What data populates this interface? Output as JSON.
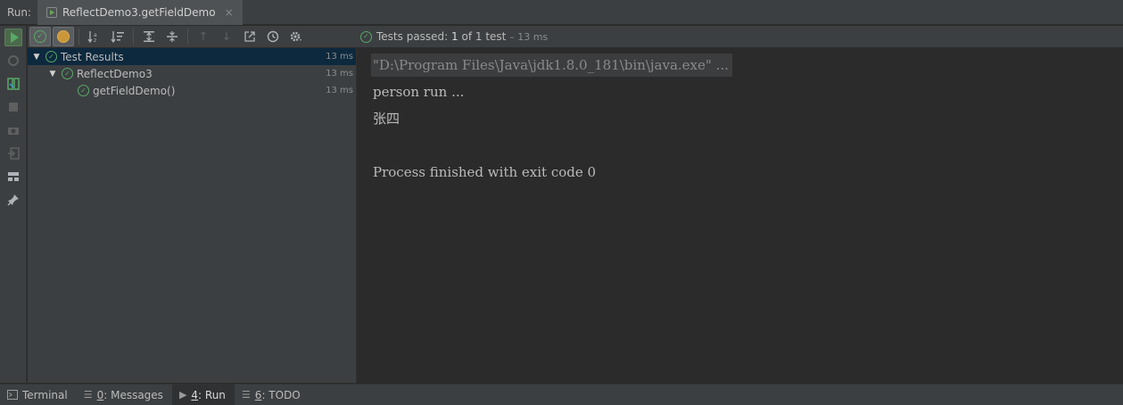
{
  "header": {
    "run_label": "Run:",
    "tab_title": "ReflectDemo3.getFieldDemo",
    "tab_close": "×"
  },
  "toolbar": {
    "icons": [
      "rerun",
      "show-passed",
      "show-ignored",
      "sort-alpha",
      "sort-duration",
      "expand-all",
      "collapse-all",
      "prev-failed",
      "next-failed",
      "export",
      "history",
      "settings"
    ]
  },
  "status": {
    "prefix": "Tests passed:",
    "passed": "1",
    "of_text": "of 1 test",
    "duration": "– 13 ms"
  },
  "tree": {
    "rows": [
      {
        "label": "Test Results",
        "time": "13 ms"
      },
      {
        "label": "ReflectDemo3",
        "time": "13 ms"
      },
      {
        "label": "getFieldDemo()",
        "time": "13 ms"
      }
    ]
  },
  "console": {
    "lines": [
      "\"D:\\Program Files\\Java\\jdk1.8.0_181\\bin\\java.exe\" ...",
      "person run ...",
      "张四",
      "",
      "Process finished with exit code 0"
    ]
  },
  "bottom": {
    "terminal": "Terminal",
    "messages_num": "0",
    "messages": ": Messages",
    "run_num": "4",
    "run": ": Run",
    "todo_num": "6",
    "todo": ": TODO"
  },
  "colors": {
    "pass_green": "#59a869",
    "selection": "#0d293e",
    "panel_bg": "#3c3f41",
    "console_bg": "#2b2b2b"
  }
}
